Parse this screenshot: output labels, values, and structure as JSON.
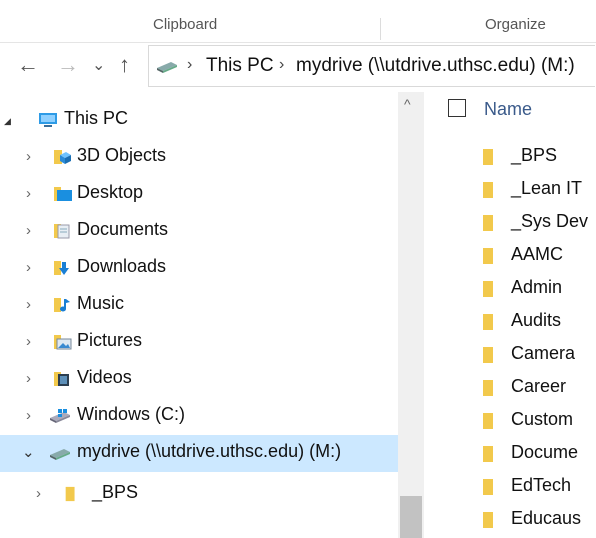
{
  "ribbon": {
    "groups": [
      "Clipboard",
      "Organize"
    ]
  },
  "address": {
    "back": "←",
    "forward": "→",
    "recent": "⌄",
    "up": "↑",
    "crumbs": [
      "This PC",
      "mydrive (\\\\utdrive.uthsc.edu) (M:)"
    ],
    "separator": "›"
  },
  "tree": {
    "items": [
      {
        "label": "This PC",
        "expander": "◢",
        "icon": "this-pc-icon"
      },
      {
        "label": "3D Objects",
        "expander": "›",
        "icon": "3d-objects-icon"
      },
      {
        "label": "Desktop",
        "expander": "›",
        "icon": "desktop-folder-icon"
      },
      {
        "label": "Documents",
        "expander": "›",
        "icon": "documents-folder-icon"
      },
      {
        "label": "Downloads",
        "expander": "›",
        "icon": "downloads-folder-icon"
      },
      {
        "label": "Music",
        "expander": "›",
        "icon": "music-folder-icon"
      },
      {
        "label": "Pictures",
        "expander": "›",
        "icon": "pictures-folder-icon"
      },
      {
        "label": "Videos",
        "expander": "›",
        "icon": "videos-folder-icon"
      },
      {
        "label": "Windows (C:)",
        "expander": "›",
        "icon": "windows-drive-icon"
      },
      {
        "label": "mydrive (\\\\utdrive.uthsc.edu) (M:)",
        "expander": "⌄",
        "icon": "network-drive-icon",
        "selected": true
      },
      {
        "label": "_BPS",
        "expander": "›",
        "icon": "folder-icon"
      }
    ]
  },
  "scrollbar": {
    "up": "^"
  },
  "file_list": {
    "column_header": "Name",
    "items": [
      "_BPS",
      "_Lean IT",
      "_Sys Dev",
      "AAMC",
      "Admin",
      "Audits",
      "Camera",
      "Career",
      "Custom",
      "Docume",
      "EdTech",
      "Educaus"
    ]
  },
  "colors": {
    "selection": "#cce8ff",
    "folder": "#f2c94c",
    "header_text": "#3a5a8a"
  }
}
